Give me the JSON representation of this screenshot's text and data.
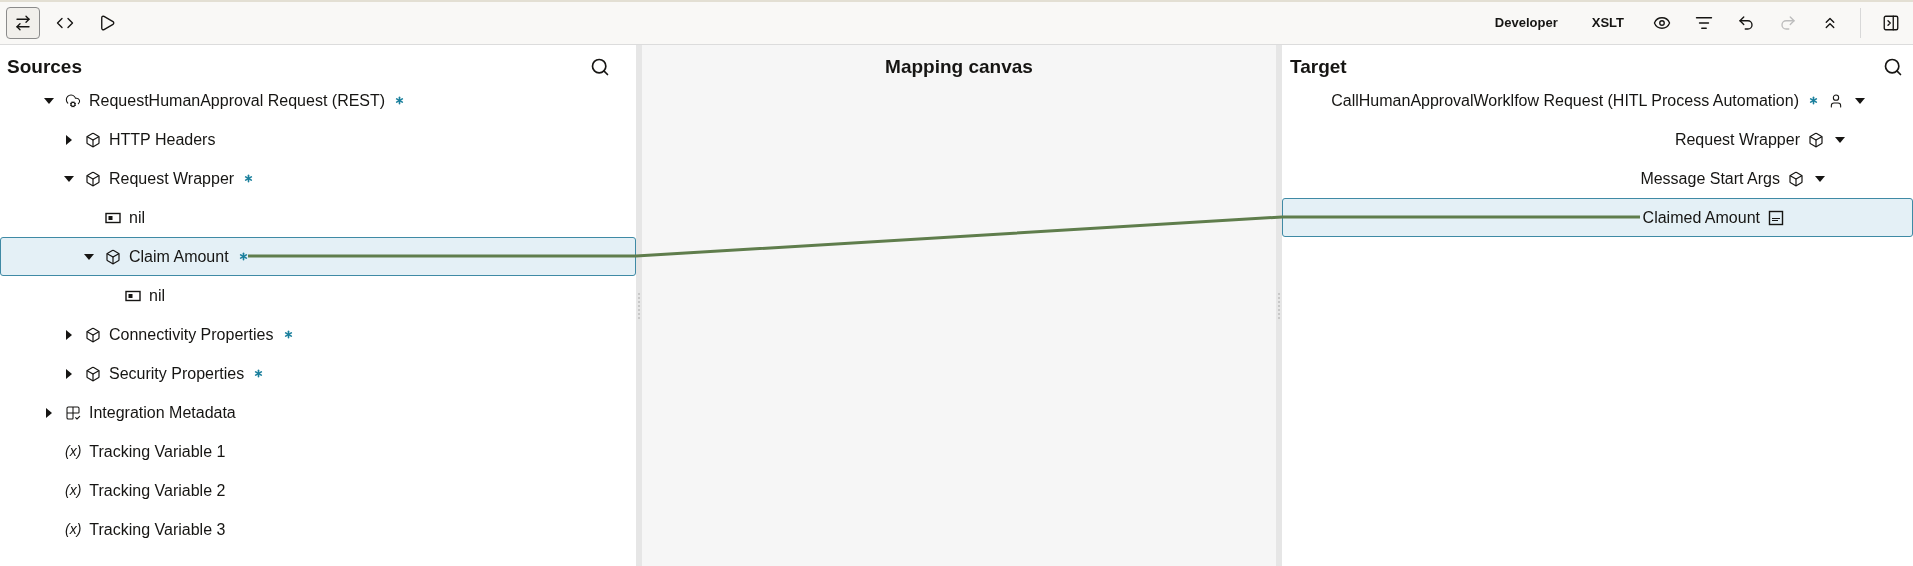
{
  "toolbar": {
    "left_tools": [
      {
        "kind": "map",
        "selected": true
      },
      {
        "kind": "code",
        "selected": false
      },
      {
        "kind": "run",
        "selected": false
      }
    ],
    "mode_buttons": [
      "Developer",
      "XSLT"
    ],
    "right_tools": [
      {
        "kind": "view",
        "disabled": false
      },
      {
        "kind": "filter",
        "disabled": false
      },
      {
        "kind": "undo",
        "disabled": false
      },
      {
        "kind": "redo",
        "disabled": true
      },
      {
        "kind": "collapse",
        "disabled": false
      }
    ],
    "panel_toggle": {
      "kind": "panel",
      "disabled": false
    }
  },
  "sources": {
    "title": "Sources",
    "tree": [
      {
        "label": "RequestHumanApproval Request (REST)",
        "kind": "rest",
        "required": true,
        "expanded": true,
        "selected": false,
        "children": [
          {
            "label": "HTTP Headers",
            "kind": "structure",
            "required": false,
            "expanded": false,
            "selected": false
          },
          {
            "label": "Request Wrapper",
            "kind": "structure",
            "required": true,
            "expanded": true,
            "selected": false,
            "children": [
              {
                "label": "nil",
                "kind": "attribute",
                "required": false,
                "selected": false
              },
              {
                "label": "Claim Amount",
                "kind": "structure",
                "required": true,
                "expanded": true,
                "selected": true,
                "children": [
                  {
                    "label": "nil",
                    "kind": "attribute",
                    "required": false,
                    "selected": false
                  }
                ]
              }
            ]
          },
          {
            "label": "Connectivity Properties",
            "kind": "structure",
            "required": true,
            "expanded": false,
            "selected": false
          },
          {
            "label": "Security Properties",
            "kind": "structure",
            "required": true,
            "expanded": false,
            "selected": false
          }
        ]
      },
      {
        "label": "Integration Metadata",
        "kind": "metadata",
        "required": false,
        "expanded": false,
        "selected": false
      },
      {
        "label": "Tracking Variable 1",
        "kind": "variable",
        "marker": "(x)",
        "required": false,
        "selected": false
      },
      {
        "label": "Tracking Variable 2",
        "kind": "variable",
        "marker": "(x)",
        "required": false,
        "selected": false
      },
      {
        "label": "Tracking Variable 3",
        "kind": "variable",
        "marker": "(x)",
        "required": false,
        "selected": false
      }
    ]
  },
  "canvas": {
    "title": "Mapping canvas"
  },
  "target": {
    "title": "Target",
    "tree": [
      {
        "label": "CallHumanApprovalWorklfow Request (HITL Process Automation)",
        "kind": "human",
        "required": true,
        "expanded": true,
        "selected": false,
        "children": [
          {
            "label": "Request Wrapper",
            "kind": "structure",
            "required": false,
            "expanded": true,
            "selected": false,
            "children": [
              {
                "label": "Message Start Args",
                "kind": "structure",
                "required": false,
                "expanded": true,
                "selected": false,
                "children": [
                  {
                    "label": "Claimed Amount",
                    "kind": "string",
                    "required": false,
                    "selected": true
                  }
                ]
              }
            ]
          }
        ]
      }
    ]
  }
}
